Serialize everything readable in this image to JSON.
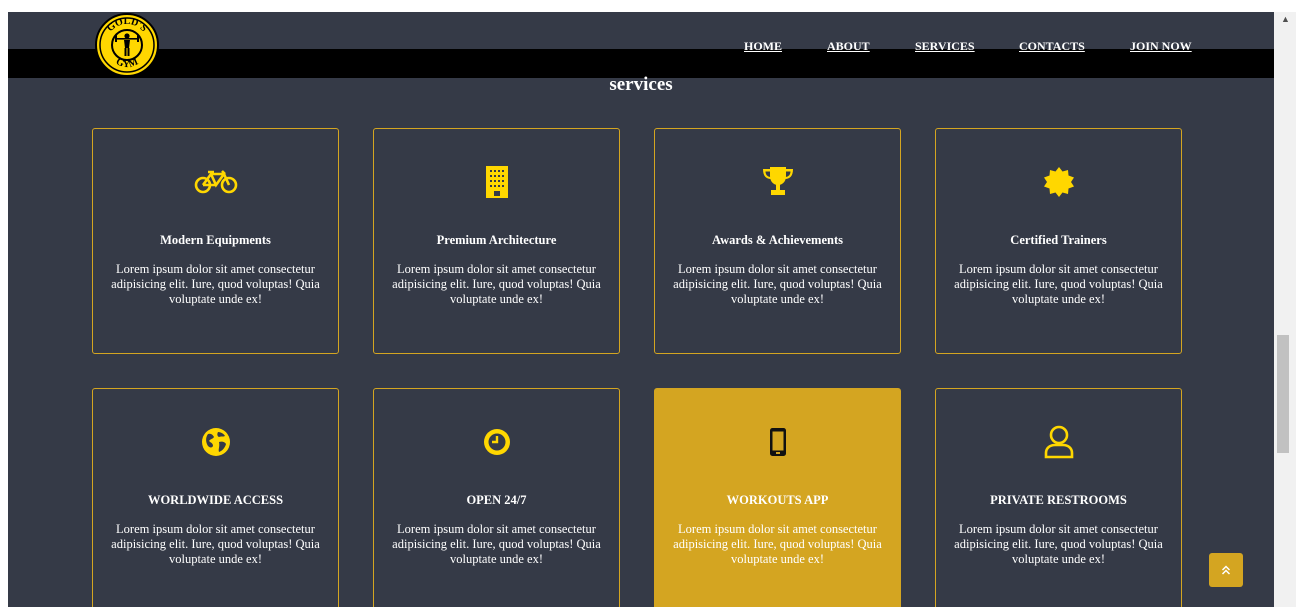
{
  "brand": {
    "logo_top_text": "GOLD'S",
    "logo_bottom_text": "GYM"
  },
  "nav": {
    "items": [
      {
        "label": "HOME"
      },
      {
        "label": "ABOUT"
      },
      {
        "label": "SERVICES"
      },
      {
        "label": "CONTACTS"
      },
      {
        "label": "JOIN NOW"
      }
    ]
  },
  "services": {
    "title": "services",
    "cards": [
      {
        "icon": "bicycle-icon",
        "title": "Modern Equipments",
        "text": "Lorem ipsum dolor sit amet consectetur adipisicing elit. Iure, quod voluptas! Quia voluptate unde ex!"
      },
      {
        "icon": "building-icon",
        "title": "Premium Architecture",
        "text": "Lorem ipsum dolor sit amet consectetur adipisicing elit. Iure, quod voluptas! Quia voluptate unde ex!"
      },
      {
        "icon": "trophy-icon",
        "title": "Awards & Achievements",
        "text": "Lorem ipsum dolor sit amet consectetur adipisicing elit. Iure, quod voluptas! Quia voluptate unde ex!"
      },
      {
        "icon": "certificate-icon",
        "title": "Certified Trainers",
        "text": "Lorem ipsum dolor sit amet consectetur adipisicing elit. Iure, quod voluptas! Quia voluptate unde ex!"
      },
      {
        "icon": "globe-icon",
        "title": "WORLDWIDE ACCESS",
        "text": "Lorem ipsum dolor sit amet consectetur adipisicing elit. Iure, quod voluptas! Quia voluptate unde ex!"
      },
      {
        "icon": "clock-icon",
        "title": "OPEN 24/7",
        "text": "Lorem ipsum dolor sit amet consectetur adipisicing elit. Iure, quod voluptas! Quia voluptate unde ex!"
      },
      {
        "icon": "mobile-phone-icon",
        "title": "WORKOUTS APP",
        "text": "Lorem ipsum dolor sit amet consectetur adipisicing elit. Iure, quod voluptas! Quia voluptate unde ex!",
        "active": true
      },
      {
        "icon": "user-icon",
        "title": "PRIVATE RESTROOMS",
        "text": "Lorem ipsum dolor sit amet consectetur adipisicing elit. Iure, quod voluptas! Quia voluptate unde ex!"
      }
    ]
  },
  "back_to_top": {
    "icon": "double-chevron-up-icon"
  },
  "colors": {
    "accent": "#d4a521",
    "icon_yellow": "#ffd700",
    "background": "#353a47",
    "navbar": "#000000"
  }
}
